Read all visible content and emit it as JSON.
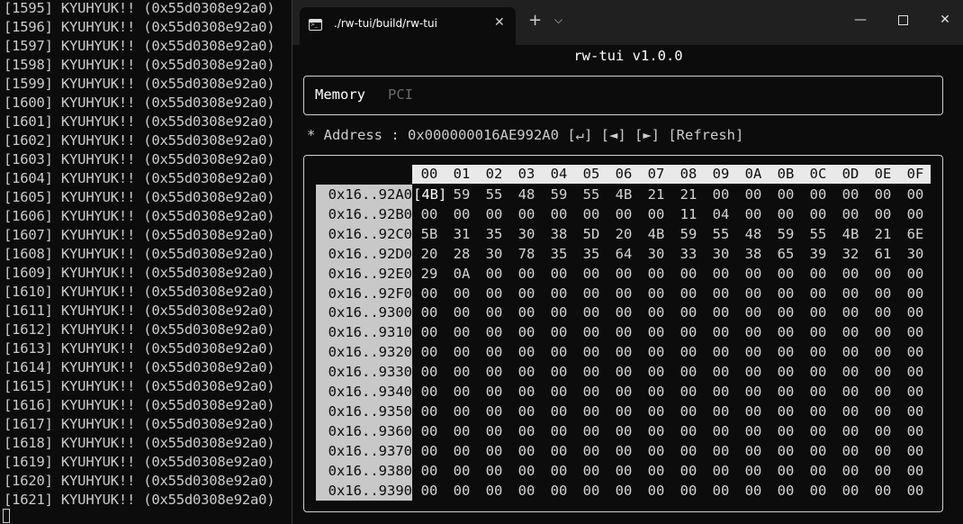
{
  "background_console": {
    "lines": [
      "[1595] KYUHYUK!! (0x55d0308e92a0)",
      "[1596] KYUHYUK!! (0x55d0308e92a0)",
      "[1597] KYUHYUK!! (0x55d0308e92a0)",
      "[1598] KYUHYUK!! (0x55d0308e92a0)",
      "[1599] KYUHYUK!! (0x55d0308e92a0)",
      "[1600] KYUHYUK!! (0x55d0308e92a0)",
      "[1601] KYUHYUK!! (0x55d0308e92a0)",
      "[1602] KYUHYUK!! (0x55d0308e92a0)",
      "[1603] KYUHYUK!! (0x55d0308e92a0)",
      "[1604] KYUHYUK!! (0x55d0308e92a0)",
      "[1605] KYUHYUK!! (0x55d0308e92a0)",
      "[1606] KYUHYUK!! (0x55d0308e92a0)",
      "[1607] KYUHYUK!! (0x55d0308e92a0)",
      "[1608] KYUHYUK!! (0x55d0308e92a0)",
      "[1609] KYUHYUK!! (0x55d0308e92a0)",
      "[1610] KYUHYUK!! (0x55d0308e92a0)",
      "[1611] KYUHYUK!! (0x55d0308e92a0)",
      "[1612] KYUHYUK!! (0x55d0308e92a0)",
      "[1613] KYUHYUK!! (0x55d0308e92a0)",
      "[1614] KYUHYUK!! (0x55d0308e92a0)",
      "[1615] KYUHYUK!! (0x55d0308e92a0)",
      "[1616] KYUHYUK!! (0x55d0308e92a0)",
      "[1617] KYUHYUK!! (0x55d0308e92a0)",
      "[1618] KYUHYUK!! (0x55d0308e92a0)",
      "[1619] KYUHYUK!! (0x55d0308e92a0)",
      "[1620] KYUHYUK!! (0x55d0308e92a0)",
      "[1621] KYUHYUK!! (0x55d0308e92a0)"
    ]
  },
  "window": {
    "tab_title": "./rw-tui/build/rw-tui",
    "tab_icon": "terminal-icon",
    "close_tab_glyph": "✕",
    "new_tab_glyph": "+",
    "dropdown_glyph": "⌵",
    "minimize_glyph": "—",
    "close_glyph": "✕"
  },
  "app": {
    "title": "rw-tui v1.0.0",
    "tabs": [
      "Memory",
      "PCI"
    ],
    "active_tab": "Memory",
    "address_prefix": "* Address : ",
    "address_value": "0x000000016AE992A0",
    "enter_button": "[↵]",
    "prev_button": "[◄]",
    "next_button": "[►]",
    "refresh_button": "[Refresh]"
  },
  "hex_view": {
    "columns": [
      "00",
      "01",
      "02",
      "03",
      "04",
      "05",
      "06",
      "07",
      "08",
      "09",
      "0A",
      "0B",
      "0C",
      "0D",
      "0E",
      "0F"
    ],
    "selected_cell": "[4B]",
    "rows": [
      {
        "label": "0x16..92A0",
        "cells": [
          "[4B]",
          "59",
          "55",
          "48",
          "59",
          "55",
          "4B",
          "21",
          "21",
          "00",
          "00",
          "00",
          "00",
          "00",
          "00",
          "00"
        ]
      },
      {
        "label": "0x16..92B0",
        "cells": [
          "00",
          "00",
          "00",
          "00",
          "00",
          "00",
          "00",
          "00",
          "11",
          "04",
          "00",
          "00",
          "00",
          "00",
          "00",
          "00"
        ]
      },
      {
        "label": "0x16..92C0",
        "cells": [
          "5B",
          "31",
          "35",
          "30",
          "38",
          "5D",
          "20",
          "4B",
          "59",
          "55",
          "48",
          "59",
          "55",
          "4B",
          "21",
          "6E"
        ]
      },
      {
        "label": "0x16..92D0",
        "cells": [
          "20",
          "28",
          "30",
          "78",
          "35",
          "35",
          "64",
          "30",
          "33",
          "30",
          "38",
          "65",
          "39",
          "32",
          "61",
          "30"
        ]
      },
      {
        "label": "0x16..92E0",
        "cells": [
          "29",
          "0A",
          "00",
          "00",
          "00",
          "00",
          "00",
          "00",
          "00",
          "00",
          "00",
          "00",
          "00",
          "00",
          "00",
          "00"
        ]
      },
      {
        "label": "0x16..92F0",
        "cells": [
          "00",
          "00",
          "00",
          "00",
          "00",
          "00",
          "00",
          "00",
          "00",
          "00",
          "00",
          "00",
          "00",
          "00",
          "00",
          "00"
        ]
      },
      {
        "label": "0x16..9300",
        "cells": [
          "00",
          "00",
          "00",
          "00",
          "00",
          "00",
          "00",
          "00",
          "00",
          "00",
          "00",
          "00",
          "00",
          "00",
          "00",
          "00"
        ]
      },
      {
        "label": "0x16..9310",
        "cells": [
          "00",
          "00",
          "00",
          "00",
          "00",
          "00",
          "00",
          "00",
          "00",
          "00",
          "00",
          "00",
          "00",
          "00",
          "00",
          "00"
        ]
      },
      {
        "label": "0x16..9320",
        "cells": [
          "00",
          "00",
          "00",
          "00",
          "00",
          "00",
          "00",
          "00",
          "00",
          "00",
          "00",
          "00",
          "00",
          "00",
          "00",
          "00"
        ]
      },
      {
        "label": "0x16..9330",
        "cells": [
          "00",
          "00",
          "00",
          "00",
          "00",
          "00",
          "00",
          "00",
          "00",
          "00",
          "00",
          "00",
          "00",
          "00",
          "00",
          "00"
        ]
      },
      {
        "label": "0x16..9340",
        "cells": [
          "00",
          "00",
          "00",
          "00",
          "00",
          "00",
          "00",
          "00",
          "00",
          "00",
          "00",
          "00",
          "00",
          "00",
          "00",
          "00"
        ]
      },
      {
        "label": "0x16..9350",
        "cells": [
          "00",
          "00",
          "00",
          "00",
          "00",
          "00",
          "00",
          "00",
          "00",
          "00",
          "00",
          "00",
          "00",
          "00",
          "00",
          "00"
        ]
      },
      {
        "label": "0x16..9360",
        "cells": [
          "00",
          "00",
          "00",
          "00",
          "00",
          "00",
          "00",
          "00",
          "00",
          "00",
          "00",
          "00",
          "00",
          "00",
          "00",
          "00"
        ]
      },
      {
        "label": "0x16..9370",
        "cells": [
          "00",
          "00",
          "00",
          "00",
          "00",
          "00",
          "00",
          "00",
          "00",
          "00",
          "00",
          "00",
          "00",
          "00",
          "00",
          "00"
        ]
      },
      {
        "label": "0x16..9380",
        "cells": [
          "00",
          "00",
          "00",
          "00",
          "00",
          "00",
          "00",
          "00",
          "00",
          "00",
          "00",
          "00",
          "00",
          "00",
          "00",
          "00"
        ]
      },
      {
        "label": "0x16..9390",
        "cells": [
          "00",
          "00",
          "00",
          "00",
          "00",
          "00",
          "00",
          "00",
          "00",
          "00",
          "00",
          "00",
          "00",
          "00",
          "00",
          "00"
        ]
      }
    ]
  }
}
